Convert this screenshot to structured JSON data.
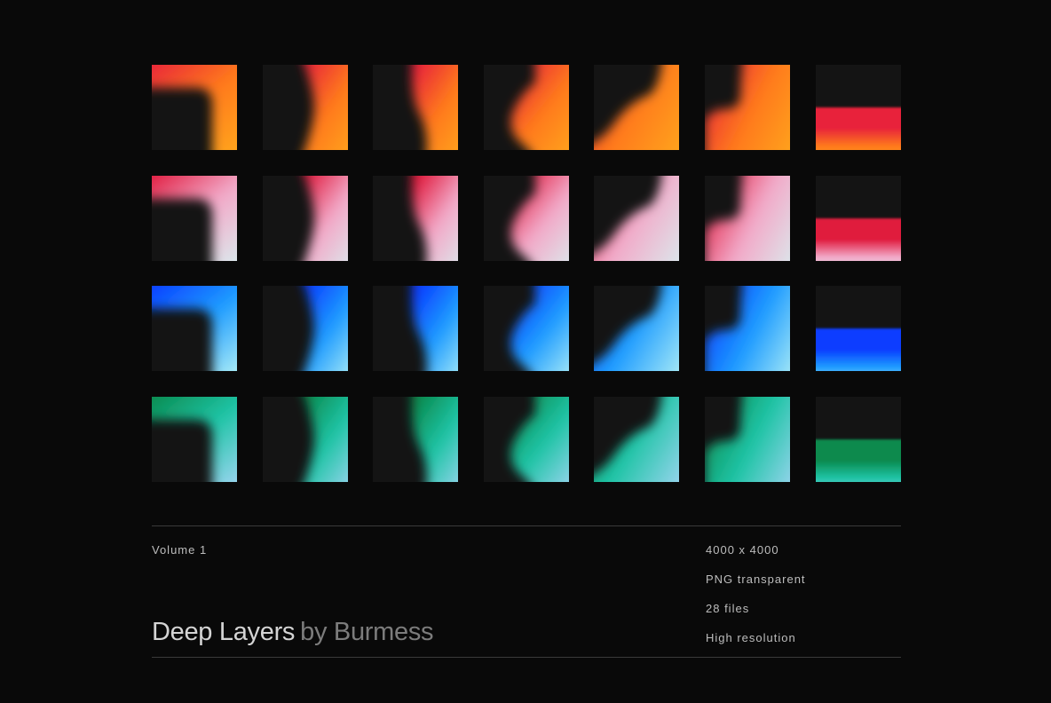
{
  "palettes": [
    {
      "name": "orange",
      "a": "#e8243a",
      "b": "#ff7a1c",
      "c": "#ffae1a"
    },
    {
      "name": "pink",
      "a": "#e01a3e",
      "b": "#f2a9c8",
      "c": "#d6f6f4"
    },
    {
      "name": "blue",
      "a": "#0a3cff",
      "b": "#1e9cff",
      "c": "#c6fcf4"
    },
    {
      "name": "green",
      "a": "#0a8a4e",
      "b": "#1fc4a6",
      "c": "#b4d8ff"
    }
  ],
  "shapes": [
    "corner-bracket",
    "chevron",
    "wave",
    "bulge",
    "diagonal-blob",
    "hook",
    "horizon-band"
  ],
  "footer": {
    "volume": "Volume 1",
    "title": "Deep Layers",
    "byline": "by Burmess",
    "specs": [
      "4000 x 4000",
      "PNG transparent",
      "28 files",
      "High resolution"
    ]
  }
}
